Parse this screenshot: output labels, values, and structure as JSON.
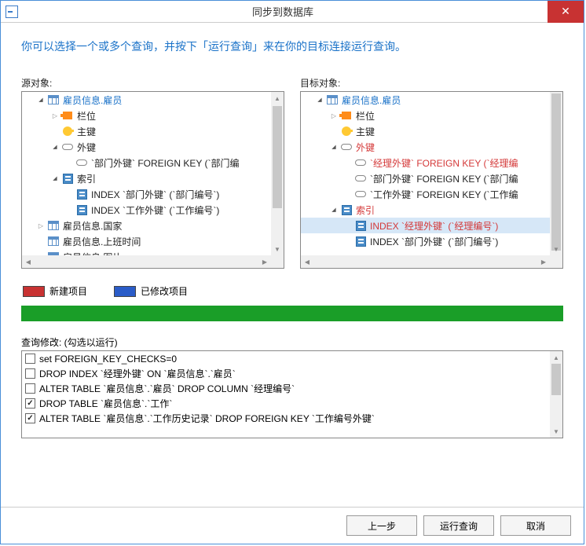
{
  "window": {
    "title": "同步到数据库",
    "close": "✕"
  },
  "instruction": "你可以选择一个或多个查询，并按下「运行查询」来在你的目标连接运行查询。",
  "panes": {
    "source_label": "源对象:",
    "target_label": "目标对象:"
  },
  "source_tree": [
    {
      "indent": 1,
      "toggle": "expanded",
      "icon": "table",
      "text": "雇员信息.雇员",
      "cls": "text-blue"
    },
    {
      "indent": 2,
      "toggle": "collapsed",
      "icon": "field",
      "text": "栏位",
      "cls": "text-black"
    },
    {
      "indent": 2,
      "toggle": "none",
      "icon": "key",
      "text": "主键",
      "cls": "text-black"
    },
    {
      "indent": 2,
      "toggle": "expanded",
      "icon": "link",
      "text": "外键",
      "cls": "text-black"
    },
    {
      "indent": 3,
      "toggle": "none",
      "icon": "link",
      "text": "`部门外键` FOREIGN KEY (`部门编",
      "cls": "text-black"
    },
    {
      "indent": 2,
      "toggle": "expanded",
      "icon": "index",
      "text": "索引",
      "cls": "text-black"
    },
    {
      "indent": 3,
      "toggle": "none",
      "icon": "index",
      "text": "INDEX `部门外键` (`部门编号`)",
      "cls": "text-black"
    },
    {
      "indent": 3,
      "toggle": "none",
      "icon": "index",
      "text": "INDEX `工作外键` (`工作编号`)",
      "cls": "text-black"
    },
    {
      "indent": 1,
      "toggle": "collapsed",
      "icon": "table",
      "text": "雇员信息.国家",
      "cls": "text-black"
    },
    {
      "indent": 1,
      "toggle": "none",
      "icon": "table",
      "text": "雇员信息.上班时间",
      "cls": "text-black"
    },
    {
      "indent": 1,
      "toggle": "none",
      "icon": "table",
      "text": "雇员信息 图片",
      "cls": "text-black"
    }
  ],
  "target_tree": [
    {
      "indent": 1,
      "toggle": "expanded",
      "icon": "table",
      "text": "雇员信息.雇员",
      "cls": "text-blue"
    },
    {
      "indent": 2,
      "toggle": "collapsed",
      "icon": "field",
      "text": "栏位",
      "cls": "text-black"
    },
    {
      "indent": 2,
      "toggle": "none",
      "icon": "key",
      "text": "主键",
      "cls": "text-black"
    },
    {
      "indent": 2,
      "toggle": "expanded",
      "icon": "link",
      "text": "外键",
      "cls": "text-red"
    },
    {
      "indent": 3,
      "toggle": "none",
      "icon": "link",
      "text": "`经理外键` FOREIGN KEY (`经理编",
      "cls": "text-red"
    },
    {
      "indent": 3,
      "toggle": "none",
      "icon": "link",
      "text": "`部门外键` FOREIGN KEY (`部门编",
      "cls": "text-black"
    },
    {
      "indent": 3,
      "toggle": "none",
      "icon": "link",
      "text": "`工作外键` FOREIGN KEY (`工作编",
      "cls": "text-black"
    },
    {
      "indent": 2,
      "toggle": "expanded",
      "icon": "index",
      "text": "索引",
      "cls": "text-red"
    },
    {
      "indent": 3,
      "toggle": "none",
      "icon": "index",
      "text": "INDEX `经理外键` (`经理编号`)",
      "cls": "text-red",
      "selected": true
    },
    {
      "indent": 3,
      "toggle": "none",
      "icon": "index",
      "text": "INDEX `部门外键` (`部门编号`)",
      "cls": "text-black"
    }
  ],
  "legend": {
    "new_label": "新建项目",
    "mod_label": "已修改项目"
  },
  "query_label": "查询修改: (勾选以运行)",
  "queries": [
    {
      "checked": false,
      "text": "set FOREIGN_KEY_CHECKS=0"
    },
    {
      "checked": false,
      "text": "DROP INDEX `经理外键` ON `雇员信息`.`雇员`"
    },
    {
      "checked": false,
      "text": "ALTER TABLE `雇员信息`.`雇员` DROP COLUMN `经理编号`"
    },
    {
      "checked": true,
      "text": "DROP TABLE `雇员信息`.`工作`"
    },
    {
      "checked": true,
      "text": "ALTER TABLE `雇员信息`.`工作历史记录` DROP FOREIGN KEY `工作编号外键`"
    }
  ],
  "buttons": {
    "back": "上一步",
    "run": "运行查询",
    "cancel": "取消"
  }
}
